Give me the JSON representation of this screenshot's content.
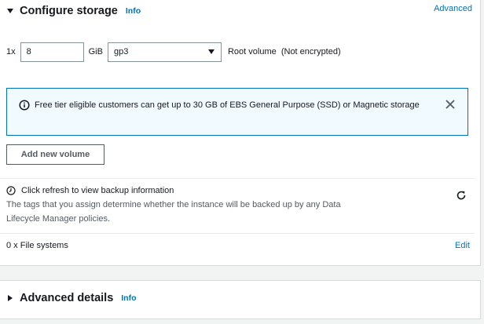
{
  "storage": {
    "title": "Configure storage",
    "info_label": "Info",
    "advanced_label": "Advanced",
    "volume": {
      "count": "1x",
      "size_value": "8",
      "unit": "GiB",
      "type_selected": "gp3",
      "description": "Root volume  (Not encrypted)"
    },
    "alert": {
      "text": "Free tier eligible customers can get up to 30 GB of EBS General Purpose (SSD) or Magnetic storage"
    },
    "add_volume_label": "Add new volume",
    "backup": {
      "title": "Click refresh to view backup information",
      "description": "The tags that you assign determine whether the instance will be backed up by any Data Lifecycle Manager policies."
    },
    "file_systems": {
      "label": "0 x File systems",
      "edit_label": "Edit"
    }
  },
  "advanced_details": {
    "title": "Advanced details",
    "info_label": "Info"
  },
  "colors": {
    "link": "#0073bb",
    "alert_bg": "#f1faff",
    "text": "#16191f",
    "secondary_text": "#545b64"
  },
  "icons": [
    "caret-down-icon",
    "info-circle-icon",
    "close-icon",
    "clock-icon",
    "refresh-icon",
    "caret-right-icon"
  ]
}
